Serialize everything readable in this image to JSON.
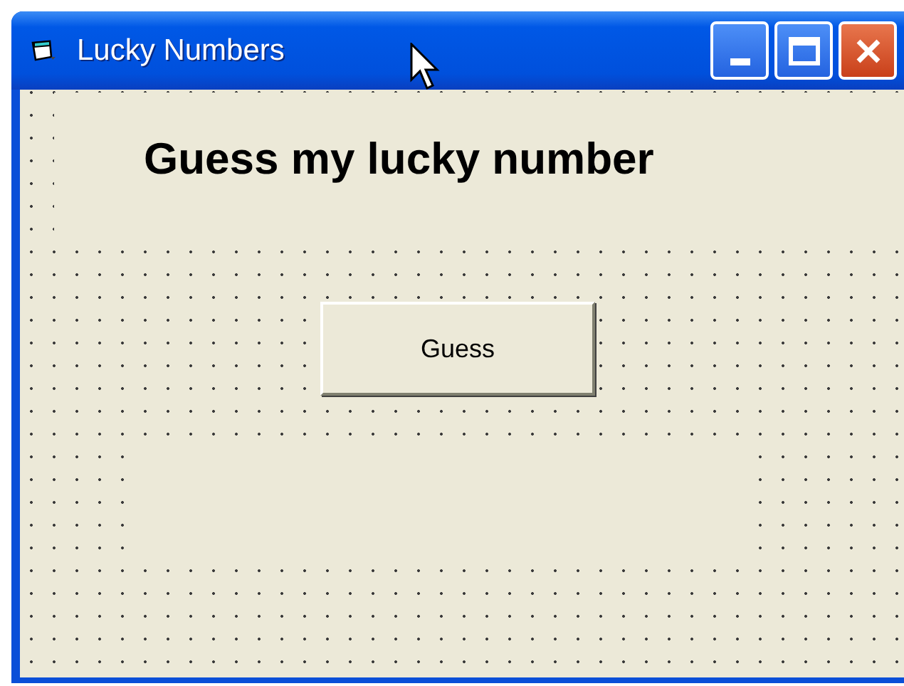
{
  "window": {
    "title": "Lucky Numbers"
  },
  "form": {
    "heading": "Guess my lucky number",
    "button": "Guess"
  }
}
